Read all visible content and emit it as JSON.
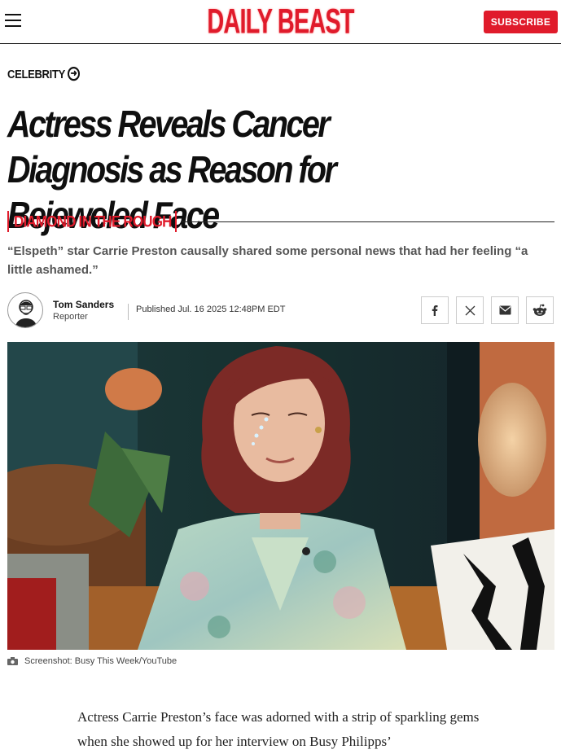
{
  "header": {
    "logo": "DAILY BEAST",
    "subscribe_label": "SUBSCRIBE",
    "menu_icon": "hamburger-icon",
    "brand_color": "#e01b2b"
  },
  "article": {
    "category": "CELEBRITY",
    "title": "Actress Reveals Cancer Diagnosis as Reason for Bejeweled Face",
    "kicker": "DIAMOND IN THE ROUGH",
    "dek": "“Elspeth” star Carrie Preston causally shared some personal news that had her feeling “a little ashamed.”",
    "author": {
      "name": "Tom Sanders",
      "role": "Reporter"
    },
    "published": "Published Jul. 16 2025 12:48PM EDT",
    "share_icons": [
      "facebook-icon",
      "x-icon",
      "email-icon",
      "reddit-icon"
    ],
    "image_caption": "Screenshot: Busy This Week/YouTube",
    "body_first": "Actress Carrie Preston’s face was adorned with a strip of sparkling gems when she showed up for her interview on Busy Philipps’"
  }
}
